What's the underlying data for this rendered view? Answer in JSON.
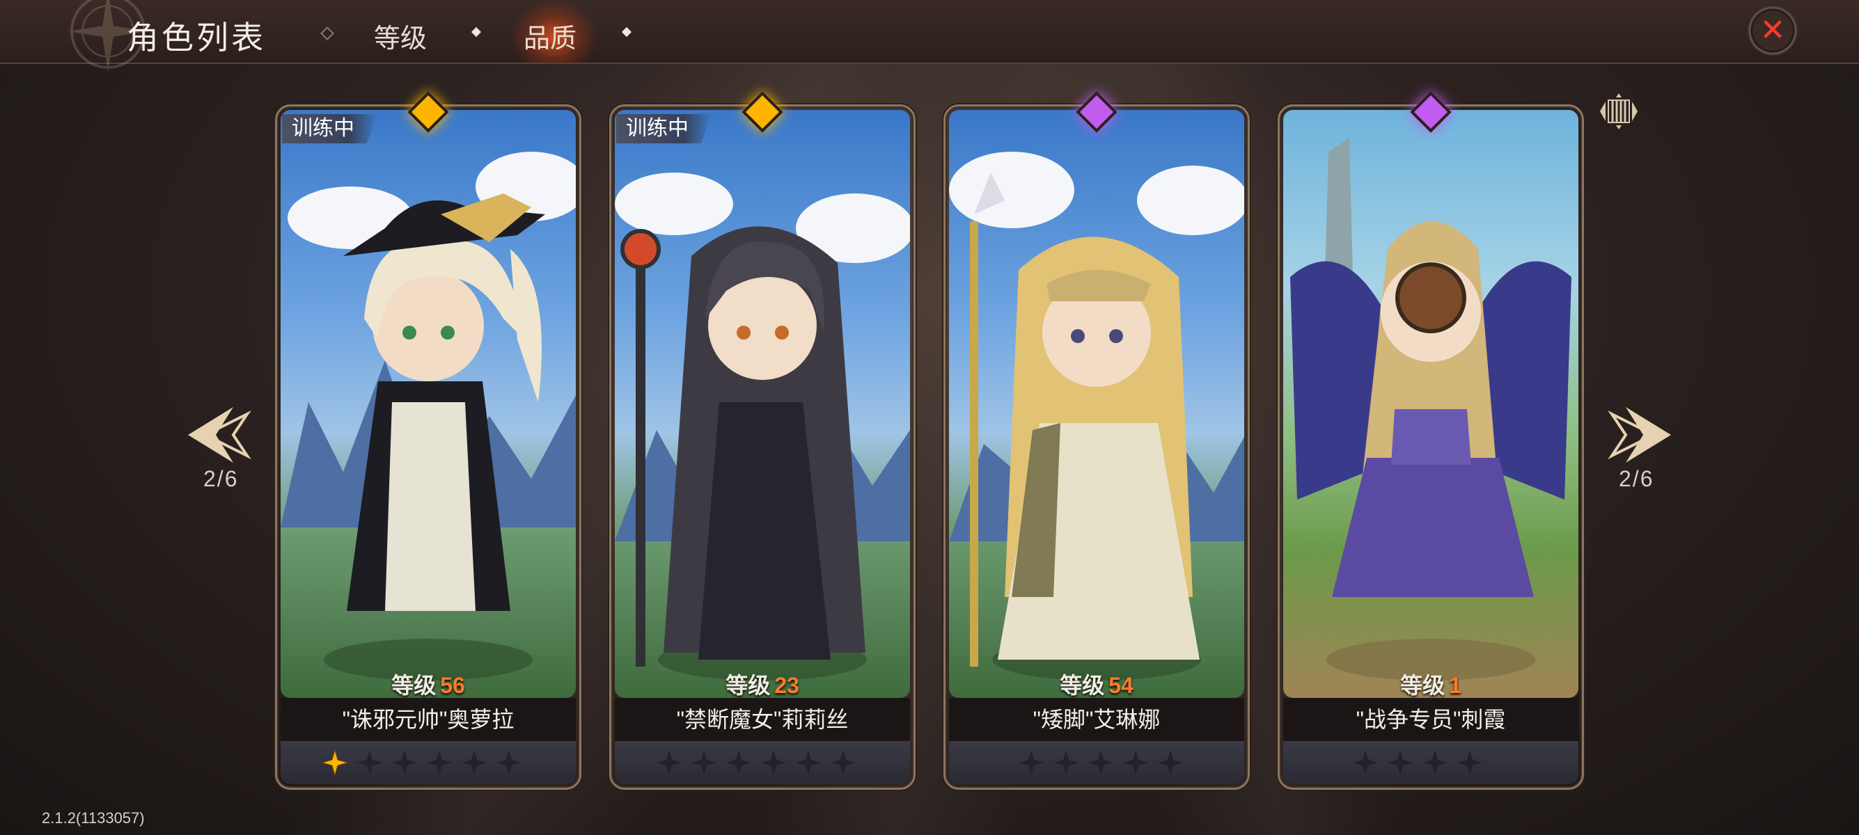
{
  "header": {
    "title": "角色列表",
    "tabs": [
      {
        "label": "等级",
        "active": false
      },
      {
        "label": "品质",
        "active": true
      }
    ]
  },
  "navigation": {
    "left_page": "2/6",
    "right_page": "2/6"
  },
  "cards": [
    {
      "status_tag": "训练中",
      "quality": "orange",
      "quality_color": "#ffb400",
      "level_label": "等级",
      "level": "56",
      "name": "\"诛邪元帅\"奥萝拉",
      "stars": 1
    },
    {
      "status_tag": "训练中",
      "quality": "orange",
      "quality_color": "#ffb400",
      "level_label": "等级",
      "level": "23",
      "name": "\"禁断魔女\"莉莉丝",
      "stars": 0
    },
    {
      "status_tag": "",
      "quality": "purple",
      "quality_color": "#c25cf0",
      "level_label": "等级",
      "level": "54",
      "name": "\"矮脚\"艾琳娜",
      "stars": 0
    },
    {
      "status_tag": "",
      "quality": "purple",
      "quality_color": "#c25cf0",
      "level_label": "等级",
      "level": "1",
      "name": "\"战争专员\"刺霞",
      "stars": 0
    }
  ],
  "version": "2.1.2(1133057)",
  "colors": {
    "level_number": "#ff7a2a",
    "close_icon": "#ff3a2a",
    "active_tab_glow": "#ff5a1e"
  }
}
